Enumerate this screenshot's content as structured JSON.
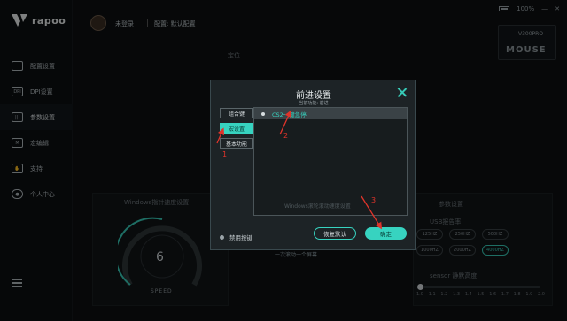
{
  "app": {
    "logo_text": "rapoo"
  },
  "topbar": {
    "user_label": "未登录",
    "config_label": "配置: 默认配置",
    "battery_percent": "100%",
    "device_model": "V300PRO",
    "device_name": "MOUSE"
  },
  "sidebar": {
    "items": [
      {
        "label": "配置设置",
        "icon": "mouse-config-icon",
        "icon_text": ""
      },
      {
        "label": "DPI设置",
        "icon": "dpi-icon",
        "icon_text": "DPI"
      },
      {
        "label": "参数设置",
        "icon": "sliders-icon",
        "icon_text": "|||",
        "active": true
      },
      {
        "label": "宏编辑",
        "icon": "macro-icon",
        "icon_text": "M"
      },
      {
        "label": "支持",
        "icon": "thumbs-up-icon",
        "icon_text": "✋"
      },
      {
        "label": "个人中心",
        "icon": "person-icon",
        "icon_text": "●"
      }
    ]
  },
  "background": {
    "left_panel_title": "Windows指针速度设置",
    "right_panel_title": "参数设置",
    "usb_rate_label": "USB报告率",
    "gauge_value": "6",
    "gauge_label": "SPEED",
    "hz_options": [
      "125HZ",
      "250HZ",
      "500HZ",
      "1000HZ",
      "2000HZ",
      "4000HZ"
    ],
    "hz_selected_index": 5,
    "sensor_label": "sensor 静默高度",
    "slider_ticks": [
      "1.0",
      "1.1",
      "1.2",
      "1.3",
      "1.4",
      "1.5",
      "1.6",
      "1.7",
      "1.8",
      "1.9",
      "2.0"
    ],
    "slider_value": 1.0,
    "ghost_option_1": "一次滚动一个屏幕",
    "ghost_center": "Windows滚轮滚动速度设置",
    "ghost_left_items": [
      "定位",
      "设置"
    ]
  },
  "dialog": {
    "title": "前进设置",
    "subtitle": "当前功能: 前进",
    "tabs": [
      "组合键",
      "宏设置",
      "基本功能"
    ],
    "active_tab_index": 1,
    "list_items": [
      "CS2一键急停"
    ],
    "disable_label": "禁用按键",
    "restore_button": "恢复默认",
    "ok_button": "确定"
  },
  "annotations": [
    "1",
    "2",
    "3"
  ],
  "colors": {
    "accent": "#37d3c0",
    "annotation": "#e0342b",
    "background": "#0d1012",
    "dialog_bg": "#1d2326"
  }
}
